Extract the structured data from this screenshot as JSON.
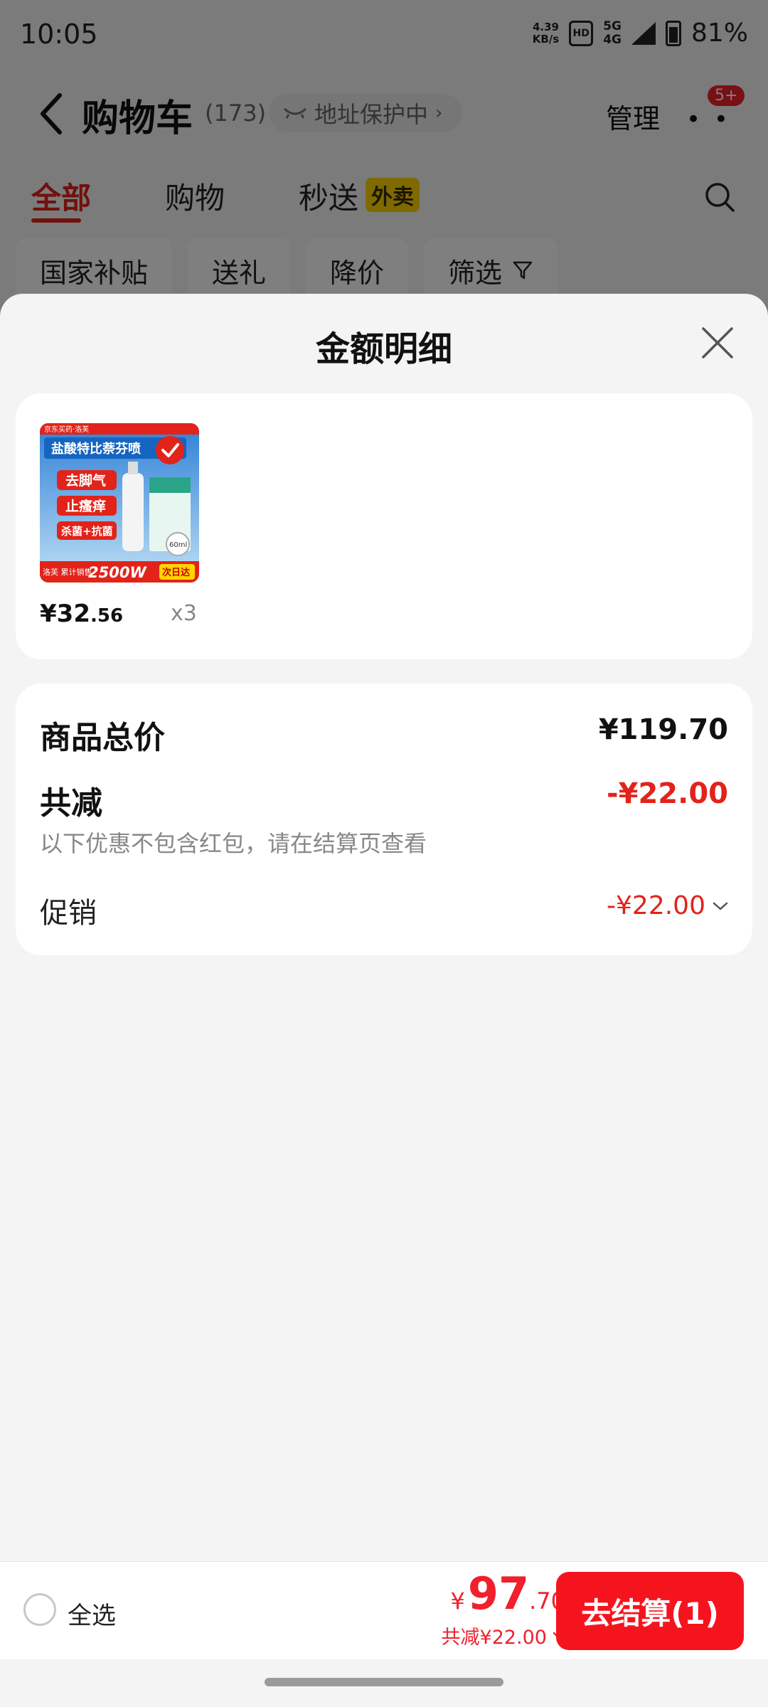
{
  "status_bar": {
    "time": "10:05",
    "net_speed_value": "4.39",
    "net_speed_unit": "KB/s",
    "hd_label": "HD",
    "signal_5g": "5G",
    "signal_4g": "4G",
    "battery": "81%"
  },
  "header": {
    "title": "购物车",
    "count": "(173)",
    "address_protect": "地址保护中",
    "manage": "管理",
    "more_badge": "5+"
  },
  "tabs": [
    {
      "label": "全部"
    },
    {
      "label": "购物"
    },
    {
      "label": "秒送",
      "tag": "外卖"
    }
  ],
  "filters": [
    "国家补贴",
    "送礼",
    "降价",
    "筛选"
  ],
  "sheet": {
    "title": "金额明细",
    "product": {
      "price_int": "¥32",
      "price_dec": ".56",
      "qty": "x3",
      "img_text": {
        "brand": "京东买药·洛芙",
        "name": "盐酸特比萘芬喷",
        "benefit1": "去脚气",
        "benefit2": "止瘙痒",
        "benefit3": "杀菌+抗菌",
        "sales": "洛芙 累计销售",
        "sales_num": "2500W",
        "volume": "60ml",
        "tag": "次日达"
      }
    },
    "summary": {
      "total_label": "商品总价",
      "total_value": "¥119.70",
      "discount_label": "共减",
      "discount_value": "-¥22.00",
      "note": "以下优惠不包含红包，请在结算页查看",
      "promo_label": "促销",
      "promo_value": "-¥22.00"
    }
  },
  "bottom": {
    "select_all": "全选",
    "currency": "¥",
    "total_int": "97",
    "total_dec": ".70",
    "discount": "共减¥22.00",
    "checkout": "去结算(1)"
  },
  "colors": {
    "accent": "#e2231a",
    "checkout_bg": "#f5141e",
    "waimai_tag": "#ffd400"
  }
}
